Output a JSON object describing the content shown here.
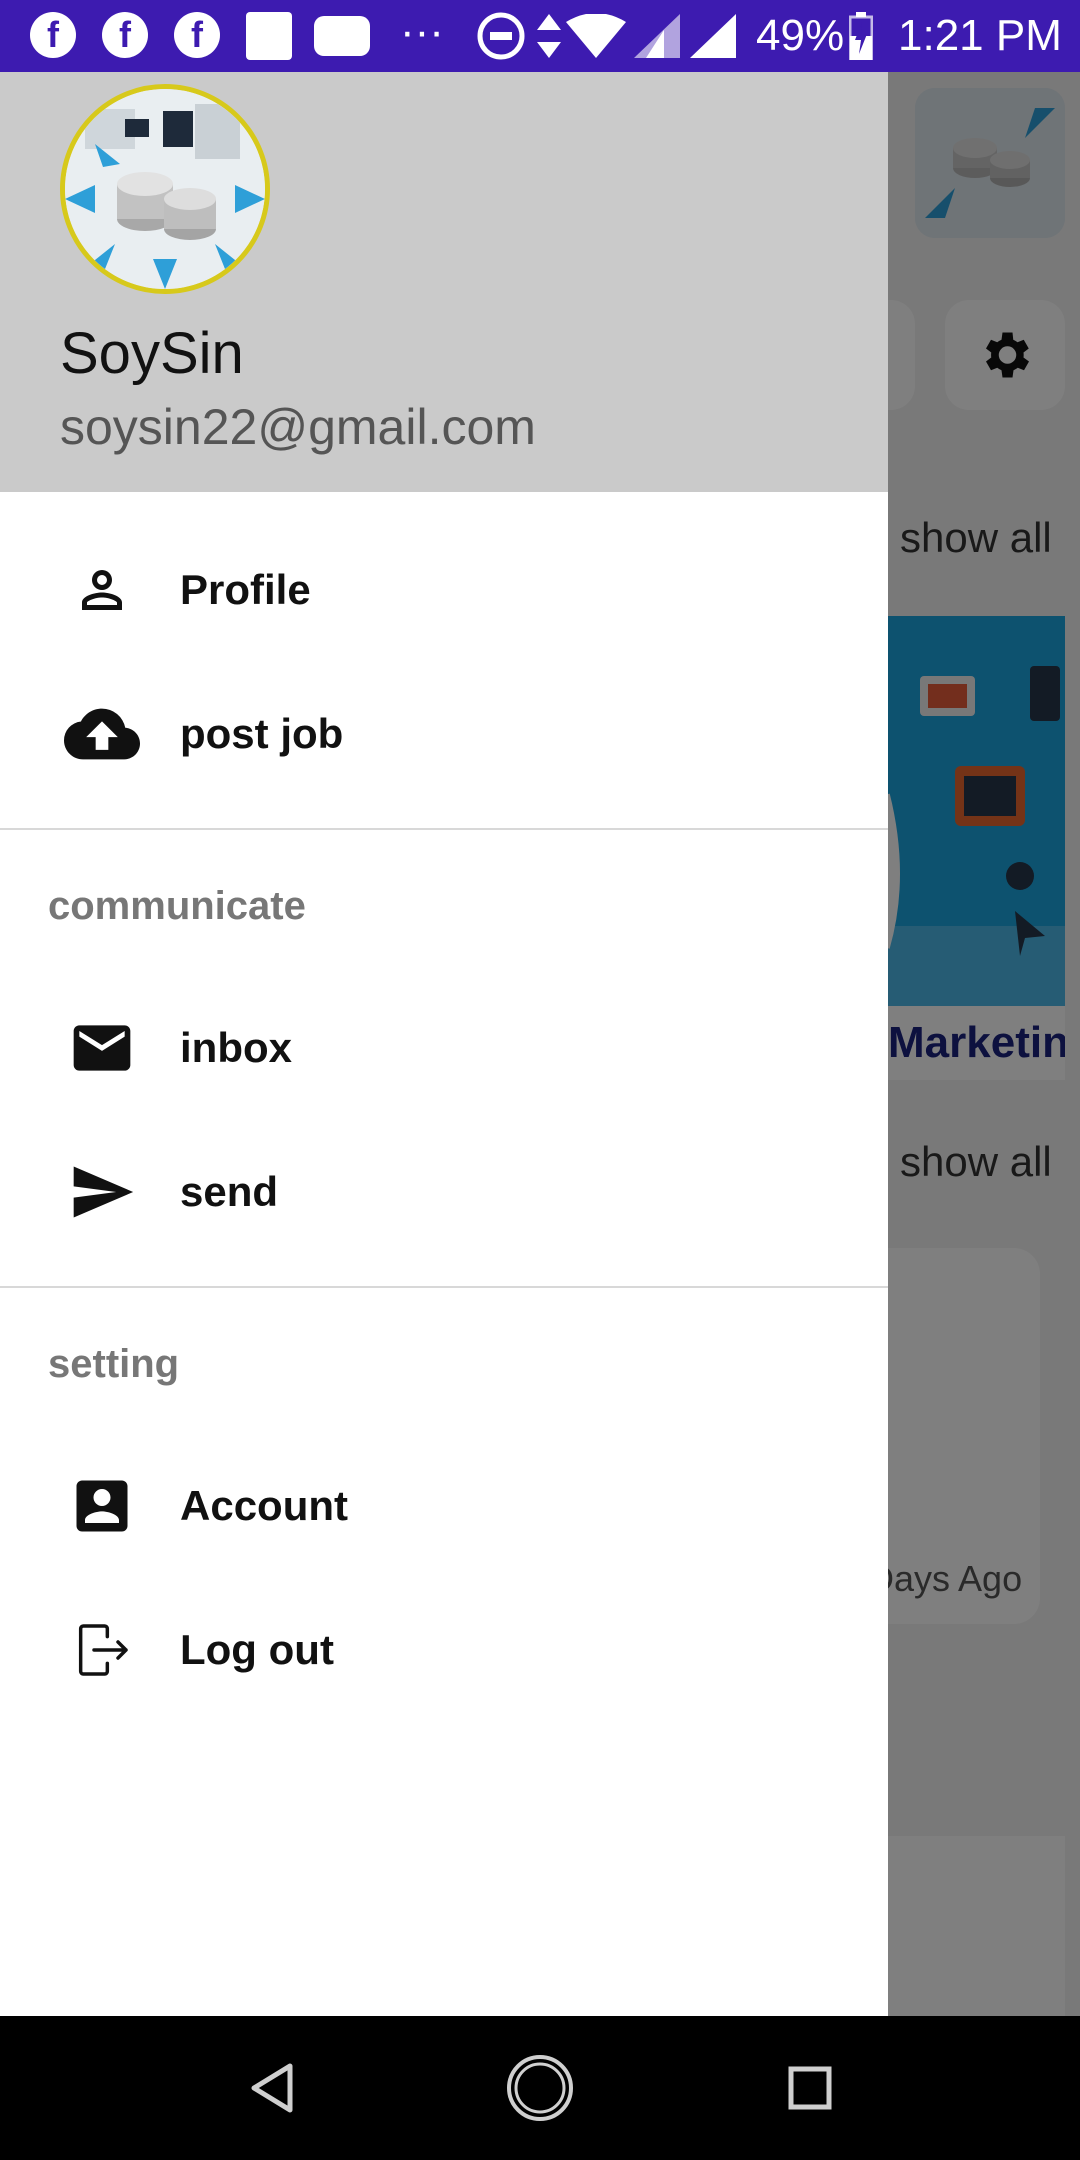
{
  "status_bar": {
    "battery": "49%",
    "time": "1:21 PM",
    "more": "···",
    "fb_glyph": "f"
  },
  "drawer": {
    "user_name": "SoySin",
    "user_email": "soysin22@gmail.com",
    "items_top": [
      {
        "label": "Profile",
        "icon": "person-outline-icon"
      },
      {
        "label": "post job",
        "icon": "cloud-upload-icon"
      }
    ],
    "communicate_title": "communicate",
    "communicate_items": [
      {
        "label": "inbox",
        "icon": "mail-icon"
      },
      {
        "label": "send",
        "icon": "send-icon"
      }
    ],
    "setting_title": "setting",
    "setting_items": [
      {
        "label": "Account",
        "icon": "account-box-icon"
      },
      {
        "label": "Log out",
        "icon": "logout-icon"
      }
    ]
  },
  "background": {
    "show_all_1": "show all",
    "show_all_2": "show all",
    "banner_title": "Marketing",
    "card_time": "Days Ago"
  },
  "colors": {
    "status_bar": "#3d1bb0",
    "drawer_header": "#cacaca",
    "avatar_ring": "#d7c91b",
    "banner": "#1aa4de"
  }
}
